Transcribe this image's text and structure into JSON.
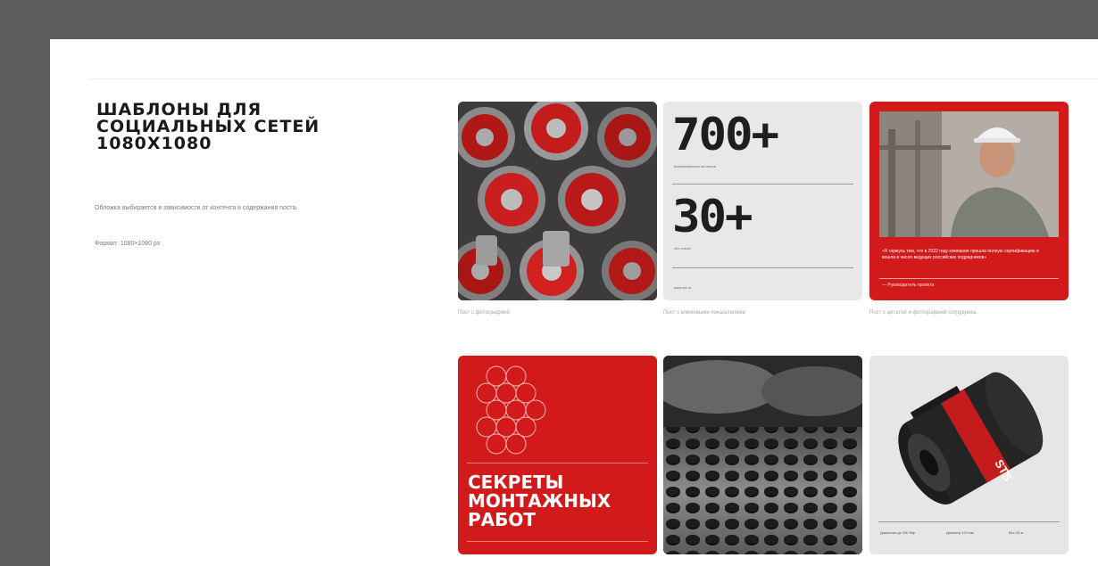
{
  "section": {
    "title_lines": [
      "ШАБЛОНЫ ДЛЯ",
      "СОЦИАЛЬНЫХ СЕТЕЙ",
      "1080X1080"
    ],
    "description": "Обложка выбирается в зависимости от контента и содержания поста.",
    "format": "Формат: 1080×1080 px"
  },
  "cards": [
    {
      "caption": "Пост с фотографией"
    },
    {
      "caption": "Пост с ключевыми показателями",
      "stat1": {
        "value": "700+",
        "label": "реализованных проектов"
      },
      "stat2": {
        "value": "30+",
        "label": "лет опыта"
      },
      "link": "www.sts.ru"
    },
    {
      "caption": "Пост с цитатой и фотографией сотрудника",
      "quote": "«Я горжусь тем, что в 2022 году компания прошла полную сертификацию и вошла в число ведущих российских подрядчиков»",
      "author": "— Руководитель проекта"
    },
    {
      "caption": "",
      "title_lines": [
        "СЕКРЕТЫ",
        "МОНТАЖНЫХ",
        "РАБОТ"
      ]
    },
    {
      "caption": ""
    },
    {
      "caption": "",
      "brand": "STS",
      "specs": [
        "Давление до 250 бар",
        "Диаметр 120 мм",
        "Вес 35 кг"
      ]
    }
  ],
  "colors": {
    "accent": "#d21a1a",
    "frame": "#5d5c5f",
    "card_gray": "#e8e8e8"
  }
}
